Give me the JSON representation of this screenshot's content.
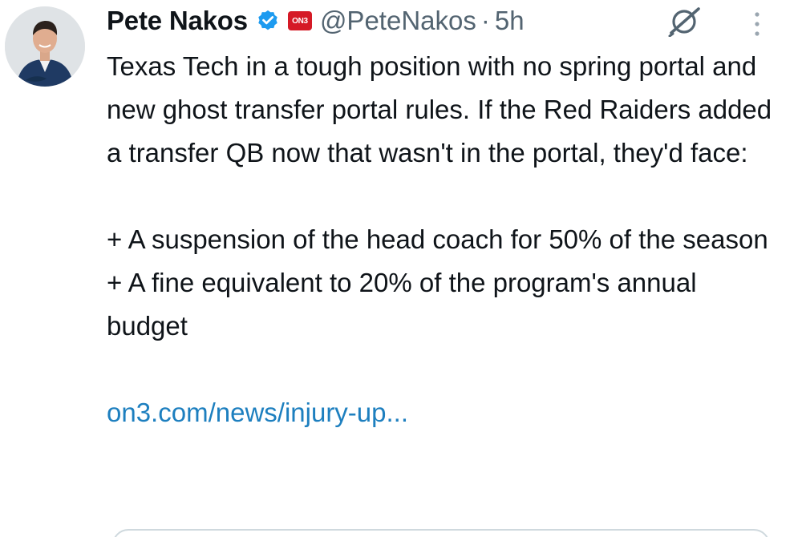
{
  "author": {
    "display_name": "Pete Nakos",
    "handle": "@PeteNakos",
    "separator": "·",
    "timestamp": "5h",
    "affiliate_badge": "ON3",
    "verified": true
  },
  "tweet": {
    "paragraph_1": "Texas Tech in a tough position with no spring portal and new ghost transfer portal rules. If the Red Raiders added a transfer QB now that wasn't in the portal, they'd face:",
    "bullet_1": "+ A suspension of the head coach for 50% of the season",
    "bullet_2": "+ A fine equivalent to 20% of the program's annual budget",
    "link": "on3.com/news/injury-up..."
  },
  "icons": {
    "verified": "verified-badge-icon",
    "grok": "grok-icon",
    "more": "more-vertical-icon",
    "affiliate": "on3-affiliate-icon"
  },
  "colors": {
    "link": "#1d7fbf",
    "verified": "#1d9bf0",
    "badge": "#d51a26",
    "secondary_text": "#536471"
  }
}
